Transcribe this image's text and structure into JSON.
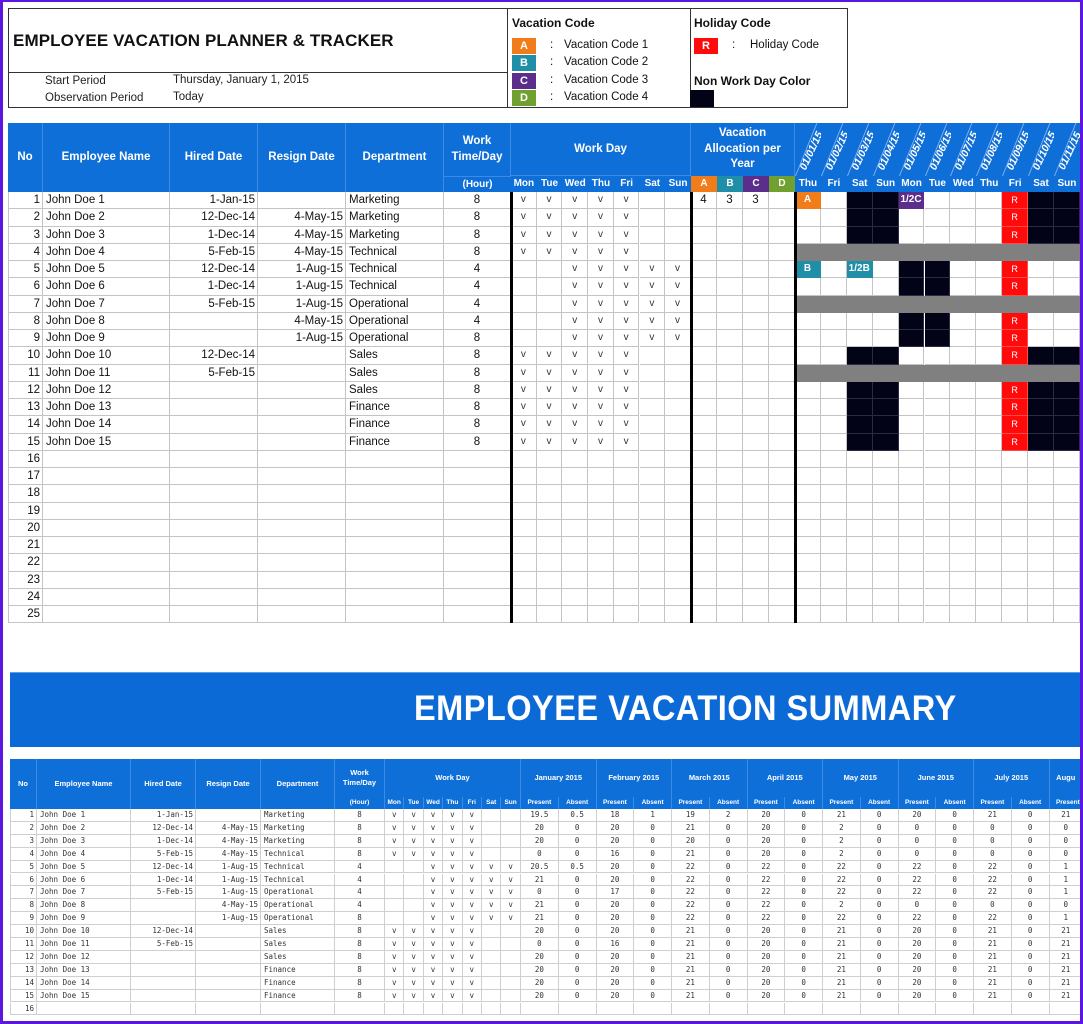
{
  "header": {
    "title": "EMPLOYEE VACATION PLANNER & TRACKER",
    "start_period_label": "Start Period",
    "start_period_value": "Thursday, January 1, 2015",
    "observation_period_label": "Observation Period",
    "observation_period_value": "Today"
  },
  "vacation_legend": {
    "title": "Vacation Code",
    "codes": [
      {
        "code": "A",
        "label": "Vacation Code 1",
        "color": "#f07d1a"
      },
      {
        "code": "B",
        "label": "Vacation Code 2",
        "color": "#1f8fa8"
      },
      {
        "code": "C",
        "label": "Vacation Code 3",
        "color": "#5a2e8a"
      },
      {
        "code": "D",
        "label": "Vacation Code 4",
        "color": "#70a030"
      }
    ],
    "separator": ":"
  },
  "holiday_legend": {
    "title": "Holiday Code",
    "code": "R",
    "label": "Holiday Code",
    "color": "#ff0b0b",
    "nonwork_title": "Non Work Day Color",
    "nonwork_color": "#030318"
  },
  "planner": {
    "columns": {
      "no": "No",
      "name": "Employee Name",
      "hired": "Hired Date",
      "resign": "Resign Date",
      "dept": "Department",
      "work_time": "Work Time/Day",
      "work_time_unit": "(Hour)",
      "work_day": "Work Day",
      "allocation": "Vacation Allocation per Year"
    },
    "weekdays": [
      "Mon",
      "Tue",
      "Wed",
      "Thu",
      "Fri",
      "Sat",
      "Sun"
    ],
    "alloc_codes": [
      "A",
      "B",
      "C",
      "D"
    ],
    "dates": [
      "01/01/15",
      "01/02/15",
      "01/03/15",
      "01/04/15",
      "01/05/15",
      "01/06/15",
      "01/07/15",
      "01/08/15",
      "01/09/15",
      "01/10/15",
      "01/11/15"
    ],
    "date_days": [
      "Thu",
      "Fri",
      "Sat",
      "Sun",
      "Mon",
      "Tue",
      "Wed",
      "Thu",
      "Fri",
      "Sat",
      "Sun"
    ],
    "check_mark": "v",
    "rows": [
      {
        "no": "1",
        "name": "John Doe 1",
        "hired": "1-Jan-15",
        "resign": "",
        "dept": "Marketing",
        "hours": "8",
        "days": [
          1,
          1,
          1,
          1,
          1,
          0,
          0
        ],
        "alloc": [
          "4",
          "3",
          "3",
          ""
        ],
        "cal": [
          "A",
          "",
          "N",
          "N",
          "1/2C",
          "",
          "",
          "",
          "R",
          "N",
          "N"
        ]
      },
      {
        "no": "2",
        "name": "John Doe 2",
        "hired": "12-Dec-14",
        "resign": "4-May-15",
        "dept": "Marketing",
        "hours": "8",
        "days": [
          1,
          1,
          1,
          1,
          1,
          0,
          0
        ],
        "alloc": [
          "",
          "",
          "",
          ""
        ],
        "cal": [
          "",
          "",
          "N",
          "N",
          "",
          "",
          "",
          "",
          "R",
          "N",
          "N"
        ]
      },
      {
        "no": "3",
        "name": "John Doe 3",
        "hired": "1-Dec-14",
        "resign": "4-May-15",
        "dept": "Marketing",
        "hours": "8",
        "days": [
          1,
          1,
          1,
          1,
          1,
          0,
          0
        ],
        "alloc": [
          "",
          "",
          "",
          ""
        ],
        "cal": [
          "",
          "",
          "N",
          "N",
          "",
          "",
          "",
          "",
          "R",
          "N",
          "N"
        ]
      },
      {
        "no": "4",
        "name": "John Doe 4",
        "hired": "5-Feb-15",
        "resign": "4-May-15",
        "dept": "Technical",
        "hours": "8",
        "days": [
          1,
          1,
          1,
          1,
          1,
          0,
          0
        ],
        "alloc": [
          "",
          "",
          "",
          ""
        ],
        "cal": "GRAY"
      },
      {
        "no": "5",
        "name": "John Doe 5",
        "hired": "12-Dec-14",
        "resign": "1-Aug-15",
        "dept": "Technical",
        "hours": "4",
        "days": [
          0,
          0,
          1,
          1,
          1,
          1,
          1
        ],
        "alloc": [
          "",
          "",
          "",
          ""
        ],
        "cal": [
          "B",
          "",
          "1/2B",
          "",
          "N",
          "N",
          "",
          "",
          "R",
          "",
          ""
        ]
      },
      {
        "no": "6",
        "name": "John Doe 6",
        "hired": "1-Dec-14",
        "resign": "1-Aug-15",
        "dept": "Technical",
        "hours": "4",
        "days": [
          0,
          0,
          1,
          1,
          1,
          1,
          1
        ],
        "alloc": [
          "",
          "",
          "",
          ""
        ],
        "cal": [
          "",
          "",
          "",
          "",
          "N",
          "N",
          "",
          "",
          "R",
          "",
          ""
        ]
      },
      {
        "no": "7",
        "name": "John Doe 7",
        "hired": "5-Feb-15",
        "resign": "1-Aug-15",
        "dept": "Operational",
        "hours": "4",
        "days": [
          0,
          0,
          1,
          1,
          1,
          1,
          1
        ],
        "alloc": [
          "",
          "",
          "",
          ""
        ],
        "cal": "GRAY"
      },
      {
        "no": "8",
        "name": "John Doe 8",
        "hired": "",
        "resign": "4-May-15",
        "dept": "Operational",
        "hours": "4",
        "days": [
          0,
          0,
          1,
          1,
          1,
          1,
          1
        ],
        "alloc": [
          "",
          "",
          "",
          ""
        ],
        "cal": [
          "",
          "",
          "",
          "",
          "N",
          "N",
          "",
          "",
          "R",
          "",
          ""
        ]
      },
      {
        "no": "9",
        "name": "John Doe 9",
        "hired": "",
        "resign": "1-Aug-15",
        "dept": "Operational",
        "hours": "8",
        "days": [
          0,
          0,
          1,
          1,
          1,
          1,
          1
        ],
        "alloc": [
          "",
          "",
          "",
          ""
        ],
        "cal": [
          "",
          "",
          "",
          "",
          "N",
          "N",
          "",
          "",
          "R",
          "",
          ""
        ]
      },
      {
        "no": "10",
        "name": "John Doe 10",
        "hired": "12-Dec-14",
        "resign": "",
        "dept": "Sales",
        "hours": "8",
        "days": [
          1,
          1,
          1,
          1,
          1,
          0,
          0
        ],
        "alloc": [
          "",
          "",
          "",
          ""
        ],
        "cal": [
          "",
          "",
          "N",
          "N",
          "",
          "",
          "",
          "",
          "R",
          "N",
          "N"
        ]
      },
      {
        "no": "11",
        "name": "John Doe 11",
        "hired": "5-Feb-15",
        "resign": "",
        "dept": "Sales",
        "hours": "8",
        "days": [
          1,
          1,
          1,
          1,
          1,
          0,
          0
        ],
        "alloc": [
          "",
          "",
          "",
          ""
        ],
        "cal": "GRAY"
      },
      {
        "no": "12",
        "name": "John Doe 12",
        "hired": "",
        "resign": "",
        "dept": "Sales",
        "hours": "8",
        "days": [
          1,
          1,
          1,
          1,
          1,
          0,
          0
        ],
        "alloc": [
          "",
          "",
          "",
          ""
        ],
        "cal": [
          "",
          "",
          "N",
          "N",
          "",
          "",
          "",
          "",
          "R",
          "N",
          "N"
        ]
      },
      {
        "no": "13",
        "name": "John Doe 13",
        "hired": "",
        "resign": "",
        "dept": "Finance",
        "hours": "8",
        "days": [
          1,
          1,
          1,
          1,
          1,
          0,
          0
        ],
        "alloc": [
          "",
          "",
          "",
          ""
        ],
        "cal": [
          "",
          "",
          "N",
          "N",
          "",
          "",
          "",
          "",
          "R",
          "N",
          "N"
        ]
      },
      {
        "no": "14",
        "name": "John Doe 14",
        "hired": "",
        "resign": "",
        "dept": "Finance",
        "hours": "8",
        "days": [
          1,
          1,
          1,
          1,
          1,
          0,
          0
        ],
        "alloc": [
          "",
          "",
          "",
          ""
        ],
        "cal": [
          "",
          "",
          "N",
          "N",
          "",
          "",
          "",
          "",
          "R",
          "N",
          "N"
        ]
      },
      {
        "no": "15",
        "name": "John Doe 15",
        "hired": "",
        "resign": "",
        "dept": "Finance",
        "hours": "8",
        "days": [
          1,
          1,
          1,
          1,
          1,
          0,
          0
        ],
        "alloc": [
          "",
          "",
          "",
          ""
        ],
        "cal": [
          "",
          "",
          "N",
          "N",
          "",
          "",
          "",
          "",
          "R",
          "N",
          "N"
        ]
      }
    ],
    "empty_row_numbers": [
      "16",
      "17",
      "18",
      "19",
      "20",
      "21",
      "22",
      "23",
      "24",
      "25"
    ]
  },
  "summary": {
    "title": "EMPLOYEE VACATION SUMMARY",
    "months": [
      "January 2015",
      "February 2015",
      "March 2015",
      "April 2015",
      "May 2015",
      "June 2015",
      "July 2015",
      "Augu"
    ],
    "present_label": "Present",
    "absent_label": "Absent",
    "rows": [
      {
        "vals": [
          "19.5",
          "0.5",
          "18",
          "1",
          "19",
          "2",
          "20",
          "0",
          "21",
          "0",
          "20",
          "0",
          "21",
          "0",
          "21"
        ]
      },
      {
        "vals": [
          "20",
          "0",
          "20",
          "0",
          "21",
          "0",
          "20",
          "0",
          "2",
          "0",
          "0",
          "0",
          "0",
          "0",
          "0"
        ]
      },
      {
        "vals": [
          "20",
          "0",
          "20",
          "0",
          "20",
          "0",
          "20",
          "0",
          "2",
          "0",
          "0",
          "0",
          "0",
          "0",
          "0"
        ]
      },
      {
        "vals": [
          "0",
          "0",
          "16",
          "0",
          "21",
          "0",
          "20",
          "0",
          "2",
          "0",
          "0",
          "0",
          "0",
          "0",
          "0"
        ]
      },
      {
        "vals": [
          "20.5",
          "0.5",
          "20",
          "0",
          "22",
          "0",
          "22",
          "0",
          "22",
          "0",
          "22",
          "0",
          "22",
          "0",
          "1"
        ]
      },
      {
        "vals": [
          "21",
          "0",
          "20",
          "0",
          "22",
          "0",
          "22",
          "0",
          "22",
          "0",
          "22",
          "0",
          "22",
          "0",
          "1"
        ]
      },
      {
        "vals": [
          "0",
          "0",
          "17",
          "0",
          "22",
          "0",
          "22",
          "0",
          "22",
          "0",
          "22",
          "0",
          "22",
          "0",
          "1"
        ]
      },
      {
        "vals": [
          "21",
          "0",
          "20",
          "0",
          "22",
          "0",
          "22",
          "0",
          "2",
          "0",
          "0",
          "0",
          "0",
          "0",
          "0"
        ]
      },
      {
        "vals": [
          "21",
          "0",
          "20",
          "0",
          "22",
          "0",
          "22",
          "0",
          "22",
          "0",
          "22",
          "0",
          "22",
          "0",
          "1"
        ]
      },
      {
        "vals": [
          "20",
          "0",
          "20",
          "0",
          "21",
          "0",
          "20",
          "0",
          "21",
          "0",
          "20",
          "0",
          "21",
          "0",
          "21"
        ]
      },
      {
        "vals": [
          "0",
          "0",
          "16",
          "0",
          "21",
          "0",
          "20",
          "0",
          "21",
          "0",
          "20",
          "0",
          "21",
          "0",
          "21"
        ]
      },
      {
        "vals": [
          "20",
          "0",
          "20",
          "0",
          "21",
          "0",
          "20",
          "0",
          "21",
          "0",
          "20",
          "0",
          "21",
          "0",
          "21"
        ]
      },
      {
        "vals": [
          "20",
          "0",
          "20",
          "0",
          "21",
          "0",
          "20",
          "0",
          "21",
          "0",
          "20",
          "0",
          "21",
          "0",
          "21"
        ]
      },
      {
        "vals": [
          "20",
          "0",
          "20",
          "0",
          "21",
          "0",
          "20",
          "0",
          "21",
          "0",
          "20",
          "0",
          "21",
          "0",
          "21"
        ]
      },
      {
        "vals": [
          "20",
          "0",
          "20",
          "0",
          "21",
          "0",
          "20",
          "0",
          "21",
          "0",
          "20",
          "0",
          "21",
          "0",
          "21"
        ]
      }
    ],
    "empty_row_numbers": [
      "16"
    ]
  }
}
